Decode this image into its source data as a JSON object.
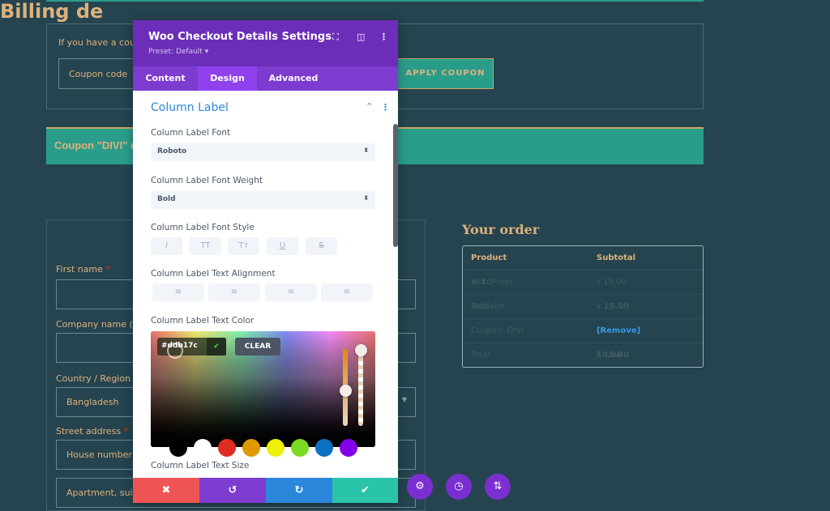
{
  "coupon": {
    "prompt": "If you have a coupo",
    "placeholder": "Coupon code",
    "apply_label": "APPLY COUPON",
    "notice": "Coupon \"DIVI\" d"
  },
  "billing": {
    "title": "Billing de",
    "fields": [
      {
        "label": "First name",
        "required": "*",
        "value": ""
      },
      {
        "label": "Company name (op",
        "required": "",
        "value": ""
      },
      {
        "label": "Country / Region",
        "required": "*",
        "value": "Bangladesh"
      },
      {
        "label": "Street address",
        "required": "*",
        "value": "House number a"
      },
      {
        "label": "",
        "required": "",
        "value": "Apartment, suite"
      }
    ]
  },
  "order": {
    "title": "Your order",
    "headers": [
      "Product",
      "Subtotal"
    ],
    "rows": [
      {
        "c1": "WordPress Music",
        "qty": "× 1",
        "c2": "৳ 15.00"
      },
      {
        "c1": "Subtotal",
        "c2": "৳ 15.00"
      },
      {
        "c1": "Coupon: DIVI",
        "c2": "-৳ 10.00",
        "link": "[Remove]"
      },
      {
        "c1": "Total",
        "c2": "৳ 15.00"
      }
    ]
  },
  "panel": {
    "title": "Woo Checkout Details Settings",
    "preset": "Preset: Default ▾",
    "tabs": [
      "Content",
      "Design",
      "Advanced"
    ],
    "active_tab": "Design",
    "section": "Column Label",
    "font_label": "Column Label Font",
    "font_value": "Roboto",
    "weight_label": "Column Label Font Weight",
    "weight_value": "Bold",
    "style_label": "Column Label Font Style",
    "style_buttons": [
      "I",
      "TT",
      "Tт",
      "U",
      "S"
    ],
    "align_label": "Column Label Text Alignment",
    "color_label": "Column Label Text Color",
    "color_value": "#ddb17c",
    "clear_label": "CLEAR",
    "swatches": [
      "#000000",
      "#ffffff",
      "#e02b20",
      "#e09900",
      "#edf000",
      "#7cda24",
      "#0c71c3",
      "#8300e9"
    ],
    "size_label": "Column Label Text Size"
  },
  "colors": {
    "accent": "#8f42ec",
    "header": "#6c2eb9",
    "cancel": "#ef5555",
    "undo": "#7e3bd0",
    "redo": "#2b87da",
    "save": "#29c4a9",
    "background": "#25444f",
    "teal": "#2a9d8a",
    "gold": "#ddb17c"
  }
}
